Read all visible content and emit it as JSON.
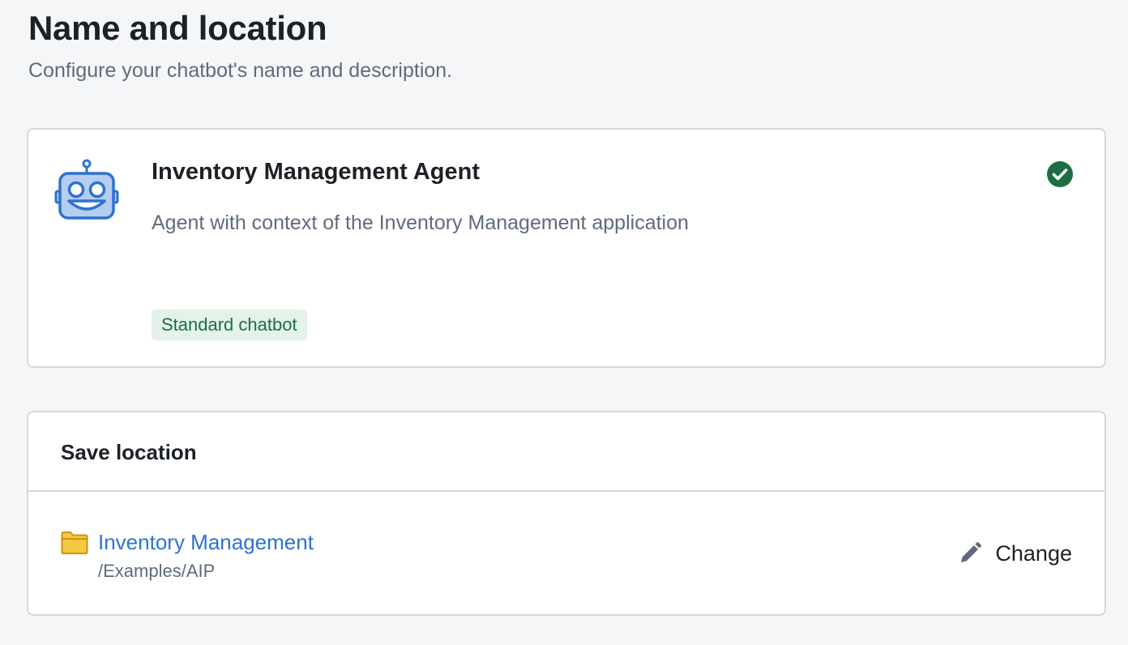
{
  "header": {
    "title": "Name and location",
    "subtitle": "Configure your chatbot's name and description."
  },
  "agent": {
    "icon": "robot-icon",
    "name": "Inventory Management Agent",
    "description": "Agent with context of the Inventory Management application",
    "status_icon": "check-circle-icon",
    "type_tag": "Standard chatbot"
  },
  "save_location": {
    "heading": "Save location",
    "folder_icon": "folder-icon",
    "folder_name": "Inventory Management",
    "folder_path": "/Examples/AIP",
    "change_icon": "pencil-icon",
    "change_label": "Change"
  },
  "colors": {
    "background": "#f5f6f8",
    "link": "#2d72d2",
    "success": "#1c6e42",
    "tag_background": "#e4f2e9",
    "robot_blue": "#2d72d2",
    "robot_fill": "#b7cdf0",
    "folder_yellow": "#f5c842"
  }
}
